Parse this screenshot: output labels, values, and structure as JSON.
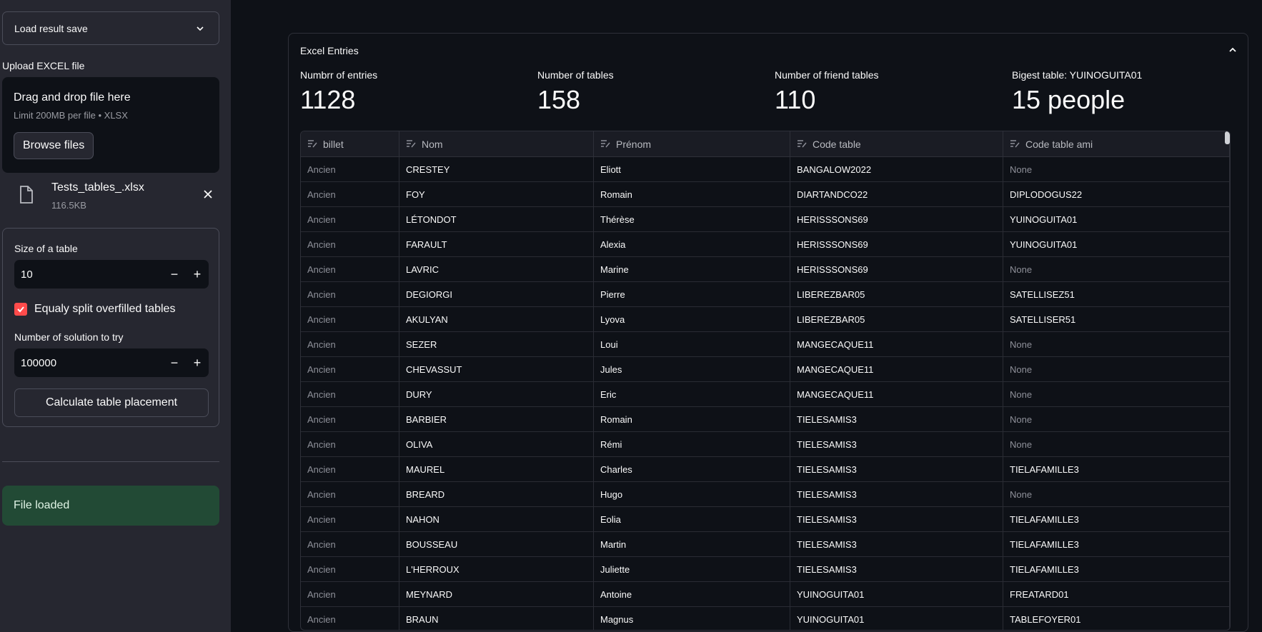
{
  "sidebar": {
    "select_label": "Load result save",
    "upload_label": "Upload EXCEL file",
    "dropzone_title": "Drag and drop file here",
    "dropzone_limit": "Limit 200MB per file • XLSX",
    "browse_label": "Browse files",
    "file_name": "Tests_tables_.xlsx",
    "file_size": "116.5KB",
    "size_label": "Size of a table",
    "size_value": "10",
    "checkbox_label": "Equaly split overfilled tables",
    "checkbox_checked": true,
    "solutions_label": "Number of solution to try",
    "solutions_value": "100000",
    "calc_label": "Calculate table placement",
    "status": "File loaded"
  },
  "main": {
    "expander_title": "Excel Entries",
    "metrics": [
      {
        "label": "Numbrr of entries",
        "value": "1128"
      },
      {
        "label": "Number of tables",
        "value": "158"
      },
      {
        "label": "Number of friend tables",
        "value": "110"
      },
      {
        "label": "Bigest table: YUINOGUITA01",
        "value": "15 people"
      }
    ],
    "columns": [
      "billet",
      "Nom",
      "Prénom",
      "Code table",
      "Code table ami"
    ],
    "rows": [
      [
        "Ancien",
        "CRESTEY",
        "Eliott",
        "BANGALOW2022",
        "None"
      ],
      [
        "Ancien",
        "FOY",
        "Romain",
        "DIARTANDCO22",
        "DIPLODOGUS22"
      ],
      [
        "Ancien",
        "LÉTONDOT",
        "Thérèse",
        "HERISSSONS69",
        "YUINOGUITA01"
      ],
      [
        "Ancien",
        "FARAULT",
        "Alexia",
        "HERISSSONS69",
        "YUINOGUITA01"
      ],
      [
        "Ancien",
        "LAVRIC",
        "Marine",
        "HERISSSONS69",
        "None"
      ],
      [
        "Ancien",
        "DEGIORGI",
        "Pierre",
        "LIBEREZBAR05",
        "SATELLISEZ51"
      ],
      [
        "Ancien",
        "AKULYAN",
        "Lyova",
        "LIBEREZBAR05",
        "SATELLISER51"
      ],
      [
        "Ancien",
        "SEZER",
        "Loui",
        "MANGECAQUE11",
        "None"
      ],
      [
        "Ancien",
        "CHEVASSUT",
        "Jules",
        "MANGECAQUE11",
        "None"
      ],
      [
        "Ancien",
        "DURY",
        "Eric",
        "MANGECAQUE11",
        "None"
      ],
      [
        "Ancien",
        "BARBIER",
        "Romain",
        "TIELESAMIS3",
        "None"
      ],
      [
        "Ancien",
        "OLIVA",
        "Rémi",
        "TIELESAMIS3",
        "None"
      ],
      [
        "Ancien",
        "MAUREL",
        "Charles",
        "TIELESAMIS3",
        "TIELAFAMILLE3"
      ],
      [
        "Ancien",
        "BREARD",
        "Hugo",
        "TIELESAMIS3",
        "None"
      ],
      [
        "Ancien",
        "NAHON",
        "Eolia",
        "TIELESAMIS3",
        "TIELAFAMILLE3"
      ],
      [
        "Ancien",
        "BOUSSEAU",
        "Martin",
        "TIELESAMIS3",
        "TIELAFAMILLE3"
      ],
      [
        "Ancien",
        "L'HERROUX",
        "Juliette",
        "TIELESAMIS3",
        "TIELAFAMILLE3"
      ],
      [
        "Ancien",
        "MEYNARD",
        "Antoine",
        "YUINOGUITA01",
        "FREATARD01"
      ],
      [
        "Ancien",
        "BRAUN",
        "Magnus",
        "YUINOGUITA01",
        "TABLEFOYER01"
      ]
    ]
  },
  "colors": {
    "background": "#0e1117",
    "sidebar": "#262730",
    "accent": "#ff4b4b",
    "success": "#224a35"
  }
}
